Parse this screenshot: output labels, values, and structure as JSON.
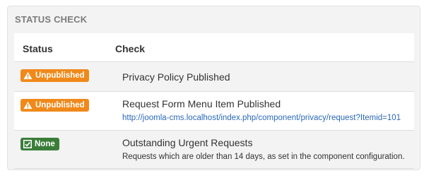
{
  "panel": {
    "title": "STATUS CHECK"
  },
  "table": {
    "headers": {
      "status": "Status",
      "check": "Check"
    },
    "rows": [
      {
        "badge": {
          "label": "Unpublished",
          "icon": "warning-icon",
          "color": "#f0891a"
        },
        "title": "Privacy Policy Published"
      },
      {
        "badge": {
          "label": "Unpublished",
          "icon": "warning-icon",
          "color": "#f0891a"
        },
        "title": "Request Form Menu Item Published",
        "link": "http://joomla-cms.localhost/index.php/component/privacy/request?Itemid=101"
      },
      {
        "badge": {
          "label": "None",
          "icon": "checkbox-checked-icon",
          "color": "#3a7d39"
        },
        "title": "Outstanding Urgent Requests",
        "description": "Requests which are older than 14 days, as set in the component configuration."
      }
    ]
  }
}
